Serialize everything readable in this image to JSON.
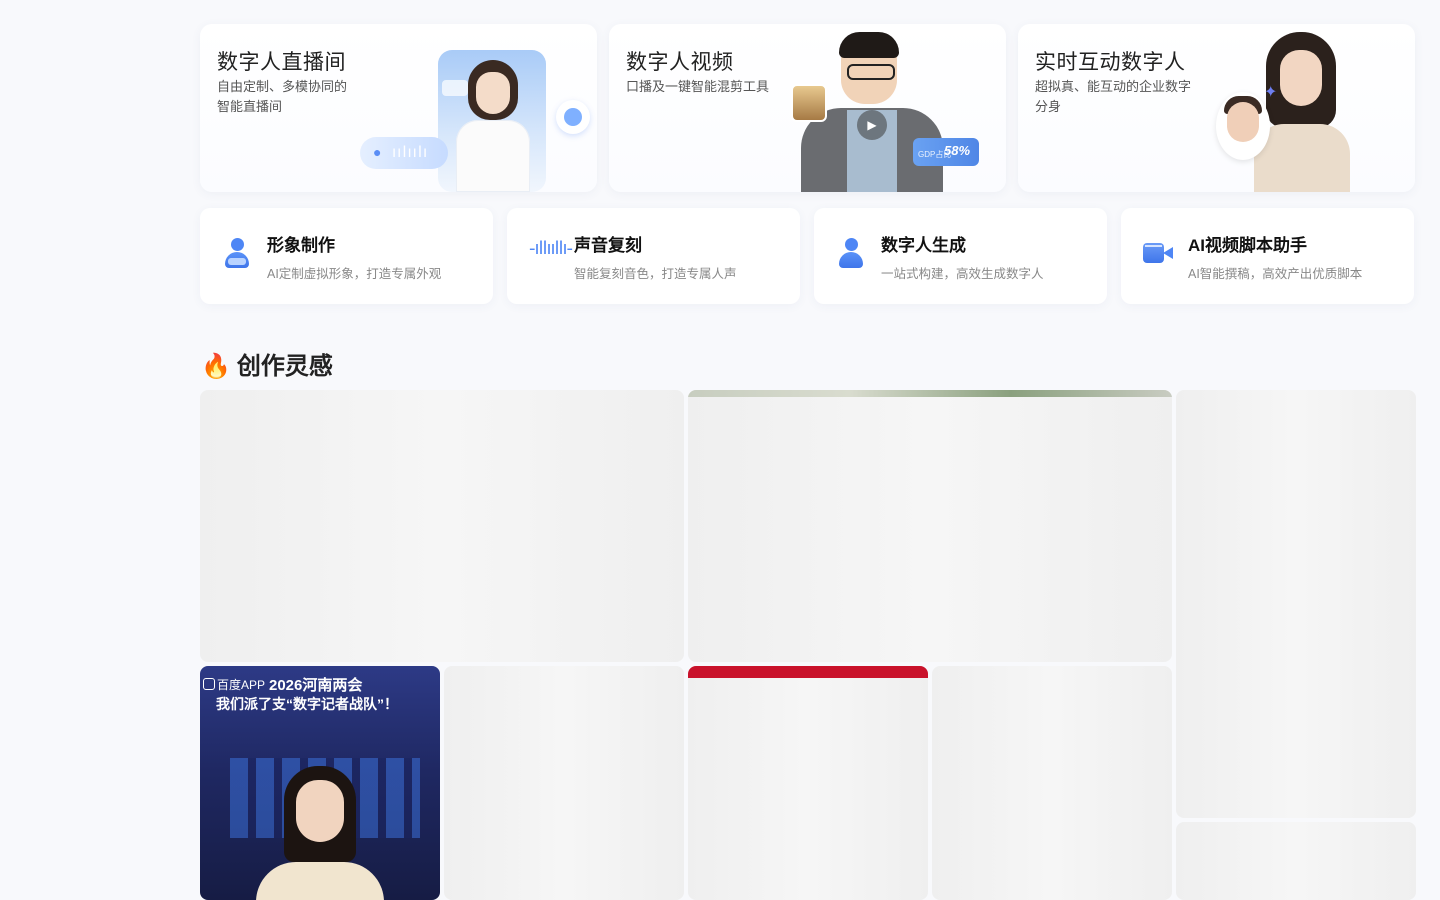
{
  "feature_cards": [
    {
      "title": "数字人直播间",
      "desc": "自由定制、多模协同的智能直播间"
    },
    {
      "title": "数字人视频",
      "desc": "口播及一键智能混剪工具",
      "stat_label": "GDP占比",
      "stat_value": "58%"
    },
    {
      "title": "实时互动数字人",
      "desc": "超拟真、能互动的企业数字分身"
    }
  ],
  "tools": [
    {
      "title": "形象制作",
      "desc": "AI定制虚拟形象，打造专属外观",
      "icon": "person-icon"
    },
    {
      "title": "声音复刻",
      "desc": "智能复刻音色，打造专属人声",
      "icon": "waveform-icon"
    },
    {
      "title": "数字人生成",
      "desc": "一站式构建，高效生成数字人",
      "icon": "person-sparkle-icon"
    },
    {
      "title": "AI视频脚本助手",
      "desc": "AI智能撰稿，高效产出优质脚本",
      "icon": "video-camera-icon"
    }
  ],
  "inspiration": {
    "title": "创作灵感",
    "icon": "flame-icon",
    "news_tile": {
      "brand": "百度APP",
      "headline1": "2026河南两会",
      "headline2": "我们派了支“数字记者战队”！"
    }
  },
  "colors": {
    "accent": "#4e86f5",
    "page_bg": "#f8f9fc",
    "flame": "#f27a22"
  }
}
